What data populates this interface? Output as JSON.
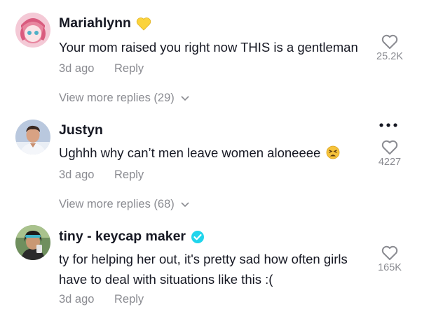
{
  "comments": [
    {
      "username": "Mariahlynn",
      "badge_icon": "yellow-heart-icon",
      "text": "Your mom raised you right now THIS is a gentleman",
      "time": "3d ago",
      "reply_label": "Reply",
      "likes": "25.2K",
      "view_more": "View more replies (29)"
    },
    {
      "username": "Justyn",
      "text": "Ughhh why can’t men leave women aloneeee",
      "emoji_icon": "tired-face-emoji-icon",
      "time": "3d ago",
      "reply_label": "Reply",
      "likes": "4227",
      "view_more": "View more replies (68)"
    },
    {
      "username": "tiny - keycap maker",
      "badge_icon": "verified-badge-icon",
      "text": "ty for helping her out, it's pretty sad how often girls have to deal with situations like this :(",
      "time": "3d ago",
      "reply_label": "Reply",
      "likes": "165K"
    }
  ],
  "colors": {
    "primary_text": "#161823",
    "secondary_text": "#8a8b91",
    "verified": "#20d5ec",
    "heart_badge": "#fbd33c"
  }
}
